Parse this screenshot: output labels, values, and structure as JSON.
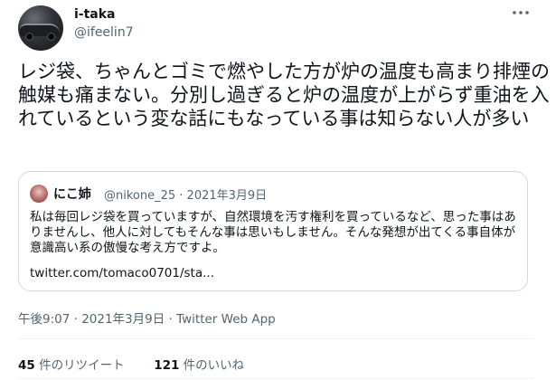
{
  "author": {
    "name": "i-taka",
    "handle": "@ifeelin7"
  },
  "more_icon": "more-horizontal-icon",
  "tweet_text": "レジ袋、ちゃんとゴミで燃やした方が炉の温度も高まり排煙の触媒も痛まない。分別し過ぎると炉の温度が上がらず重油を入れているという変な話にもなっている事は知らない人が多い",
  "quote": {
    "name": "にこ姉",
    "handle_date": "@nikone_25 · 2021年3月9日",
    "text": "私は毎回レジ袋を買っていますが、自然環境を汚す権利を買っているなど、思った事はありませんし、他人に対してもそんな事は思いもしません。そんな発想が出てくる事自体が意識高い系の傲慢な考え方ですよ。",
    "link": "twitter.com/tomaco0701/sta..."
  },
  "timestamp": "午後9:07 · 2021年3月9日 · Twitter Web App",
  "stats": {
    "retweets_count": "45",
    "retweets_label": "件のリツイート",
    "likes_count": "121",
    "likes_label": "件のいいね"
  },
  "colors": {
    "text": "#0f1419",
    "muted": "#536471",
    "border": "#cfd9de",
    "divider": "#eff3f4"
  }
}
